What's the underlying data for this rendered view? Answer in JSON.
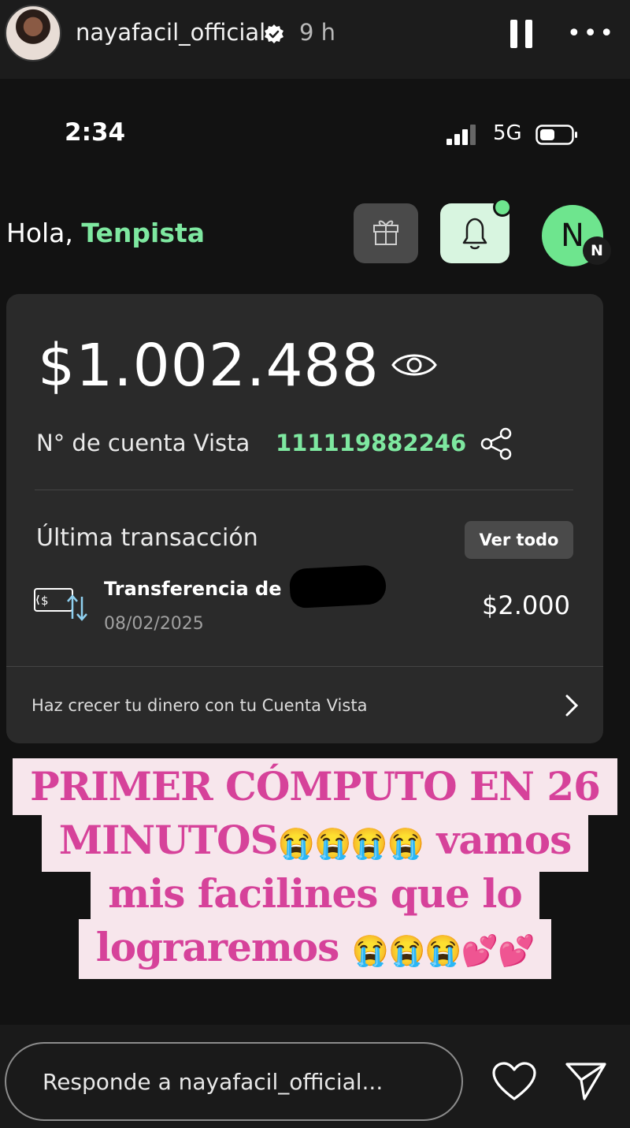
{
  "story": {
    "username": "nayafacil_official",
    "time_ago": "9 h",
    "more_label": "•••"
  },
  "phone": {
    "status_time": "2:34",
    "network": "5G"
  },
  "app": {
    "greeting": "Hola,",
    "user_name": "Tenpista",
    "avatar_letter": "N",
    "avatar_badge": "N",
    "balance": "$1.002.488",
    "account_label": "N° de cuenta Vista",
    "account_number": "111119882246",
    "last_tx_label": "Última transacción",
    "see_all": "Ver todo",
    "tx_title": "Transferencia de",
    "tx_date": "08/02/2025",
    "tx_amount": "$2.000",
    "promo": "Haz crecer tu dinero con tu Cuenta Vista"
  },
  "caption": {
    "line1": "PRIMER CÓMPUTO EN 26",
    "line2_a": "MINUTOS",
    "line2_emoji": "😭😭😭😭",
    "line2_b": " vamos",
    "line3": "mis facilines que lo",
    "line4_a": "lograremos ",
    "line4_emoji": "😭😭😭💕💕"
  },
  "reply": {
    "placeholder": "Responde a nayafacil_official..."
  },
  "colors": {
    "accent_green": "#7ee8a0",
    "caption_pink": "#d6429a",
    "caption_bg": "#f7e6ec"
  },
  "icons": [
    "verified-icon",
    "pause-icon",
    "more-icon",
    "signal-icon",
    "battery-icon",
    "gift-icon",
    "bell-icon",
    "eye-icon",
    "share-icon",
    "transfer-icon",
    "chevron-right-icon",
    "heart-icon",
    "send-icon"
  ]
}
